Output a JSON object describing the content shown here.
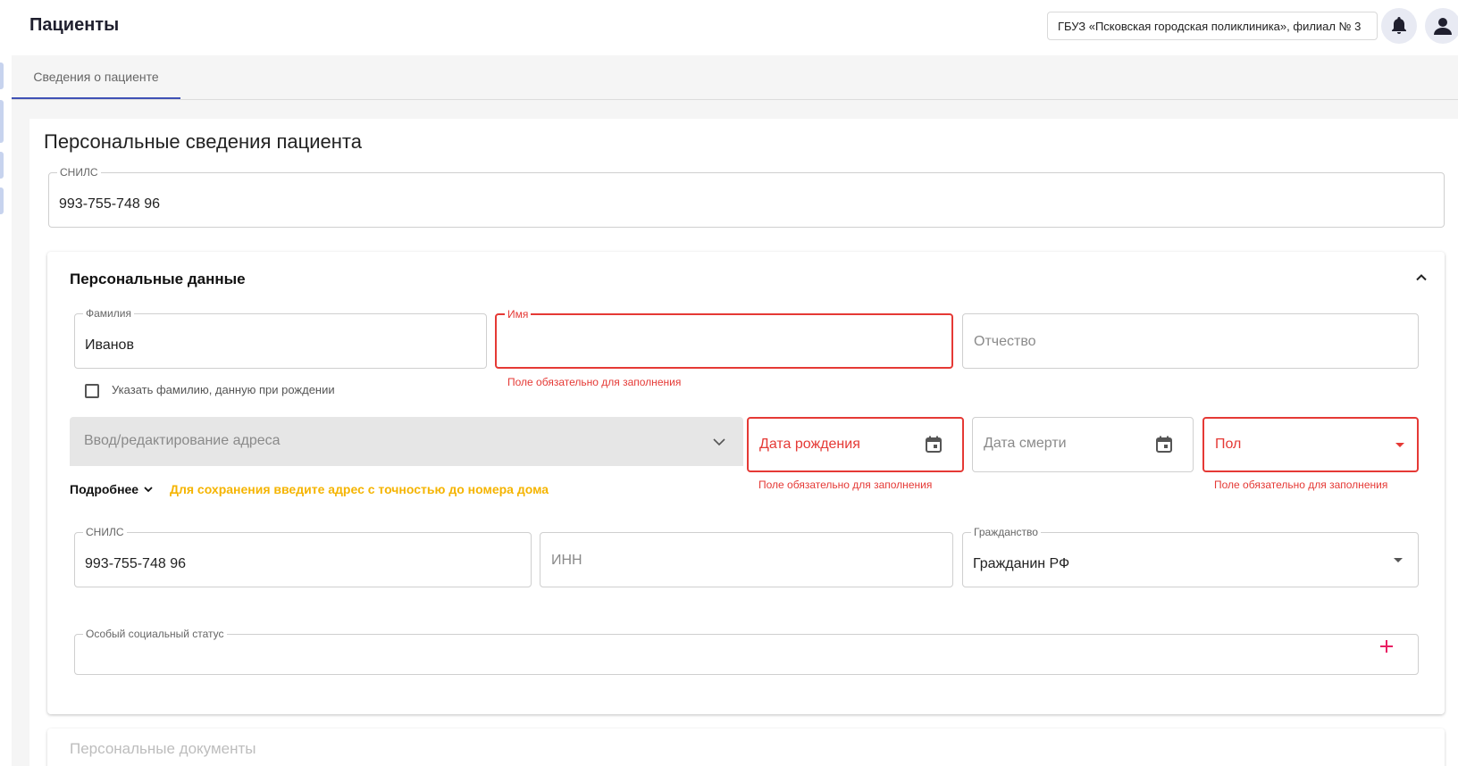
{
  "header": {
    "title": "Пациенты",
    "organization": "ГБУЗ «Псковская городская поликлиника», филиал № 3",
    "bell_icon": "bell-icon",
    "user_icon": "user-icon"
  },
  "tabs": [
    {
      "label": "Сведения о пациенте",
      "active": true
    }
  ],
  "main": {
    "section_title": "Персональные сведения пациента",
    "snils_top": {
      "label": "СНИЛС",
      "value": "993-755-748 96"
    }
  },
  "personal": {
    "title": "Персональные данные",
    "surname": {
      "label": "Фамилия",
      "value": "Иванов"
    },
    "name": {
      "label": "Имя",
      "value": "",
      "error": "Поле обязательно для заполнения"
    },
    "patronymic": {
      "placeholder": "Отчество"
    },
    "birth_surname_checkbox": {
      "label": "Указать фамилию, данную при рождении",
      "checked": false
    },
    "address": {
      "placeholder": "Ввод/редактирование адреса"
    },
    "more_label": "Подробнее",
    "address_warning": "Для сохранения введите адрес с точностью до номера дома",
    "birth_date": {
      "placeholder": "Дата рождения",
      "error": "Поле обязательно для заполнения"
    },
    "death_date": {
      "placeholder": "Дата смерти"
    },
    "gender": {
      "placeholder": "Пол",
      "error": "Поле обязательно для заполнения"
    },
    "snils": {
      "label": "СНИЛС",
      "value": "993-755-748 96"
    },
    "inn": {
      "placeholder": "ИНН"
    },
    "citizenship": {
      "label": "Гражданство",
      "value": "Гражданин РФ"
    },
    "social_status": {
      "label": "Особый социальный статус"
    }
  },
  "documents": {
    "title": "Персональные документы"
  },
  "colors": {
    "error": "#e53935",
    "warning": "#f5b400",
    "accent": "#3f51b5",
    "add_icon": "#e91e63"
  }
}
